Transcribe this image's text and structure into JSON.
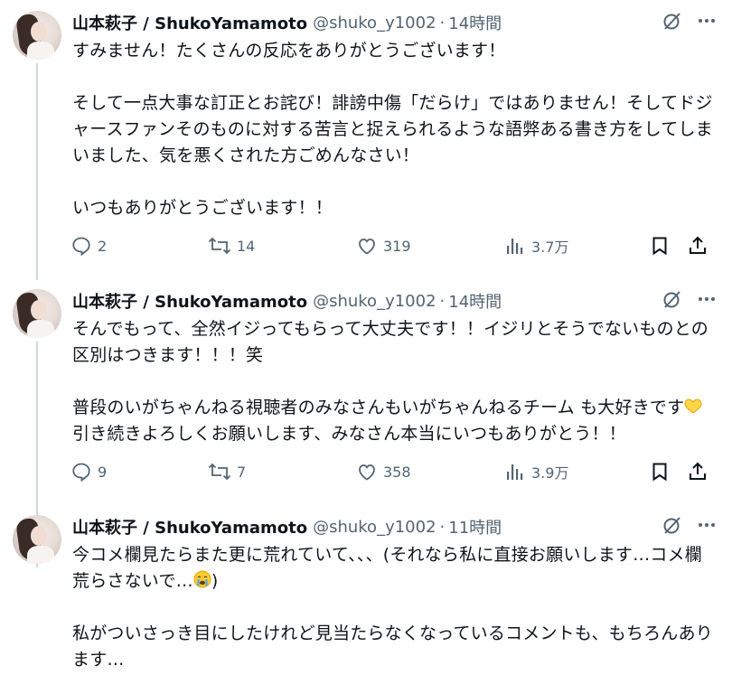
{
  "tweets": [
    {
      "name": "山本萩子 / ShukoYamamoto",
      "handle": "@shuko_y1002",
      "time": "14時間",
      "text": "すみません！たくさんの反応をありがとうございます！\n\nそして一点大事な訂正とお詫び！誹謗中傷「だらけ」ではありません！そしてドジャースファンそのものに対する苦言と捉えられるような語弊ある書き方をしてしまいました、気を悪くされた方ごめんなさい！\n\nいつもありがとうございます！！",
      "replies": "2",
      "retweets": "14",
      "likes": "319",
      "views": "3.7万"
    },
    {
      "name": "山本萩子 / ShukoYamamoto",
      "handle": "@shuko_y1002",
      "time": "14時間",
      "text_before_emoji": "そんでもって、全然イジってもらって大丈夫です！！イジリとそうでないものとの区別はつきます！！！笑\n\n普段のいがちゃんねる視聴者のみなさんもいがちゃんねるチーム も大好きです",
      "text_after_emoji": "引き続きよろしくお願いします、みなさん本当にいつもありがとう！！",
      "replies": "9",
      "retweets": "7",
      "likes": "358",
      "views": "3.9万"
    },
    {
      "name": "山本萩子 / ShukoYamamoto",
      "handle": "@shuko_y1002",
      "time": "11時間",
      "text_before_emoji": "今コメ欄見たらまた更に荒れていて、、、(それなら私に直接お願いします…コメ欄荒らさないで…",
      "text_after_emoji": ")\n\n私がついさっき目にしたけれど見当たらなくなっているコメントも、もちろんあります…"
    }
  ],
  "icons": {
    "grok": "grok-icon",
    "more": "more-icon",
    "reply": "reply-icon",
    "retweet": "retweet-icon",
    "like": "heart-icon",
    "views": "views-icon",
    "bookmark": "bookmark-icon",
    "share": "share-icon"
  },
  "colors": {
    "text": "#0f1419",
    "secondary": "#536471",
    "thread_line": "#cfd9de"
  }
}
